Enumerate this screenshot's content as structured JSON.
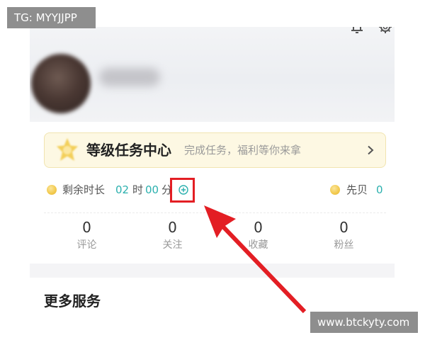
{
  "watermarks": {
    "top_left": "TG: MYYJJPP",
    "bottom_right": "www.btckyty.com"
  },
  "header": {
    "icons": {
      "notification": "bell-icon",
      "settings": "gear-icon"
    }
  },
  "level_task_banner": {
    "icon": "level-badge-icon",
    "title": "等级任务中心",
    "subtitle": "完成任务，福利等你来拿",
    "chevron_icon": "chevron-right-icon"
  },
  "remaining_time": {
    "icon": "coin-icon",
    "label": "剩余时长",
    "hours": "02",
    "hours_unit": "时",
    "minutes": "00",
    "minutes_unit": "分",
    "add_icon": "plus-circle-icon"
  },
  "coins": {
    "icon": "coin-icon",
    "label": "先贝",
    "value": "0"
  },
  "stats": [
    {
      "value": "0",
      "label": "评论"
    },
    {
      "value": "0",
      "label": "关注"
    },
    {
      "value": "0",
      "label": "收藏"
    },
    {
      "value": "0",
      "label": "粉丝"
    }
  ],
  "more_services": {
    "title": "更多服务"
  },
  "colors": {
    "accent": "#2bb0ae",
    "annotation_red": "#e31e24",
    "banner_bg": "#fdf8e3",
    "coin": "#f2c94c",
    "watermark_bg": "#8e8e8e"
  }
}
